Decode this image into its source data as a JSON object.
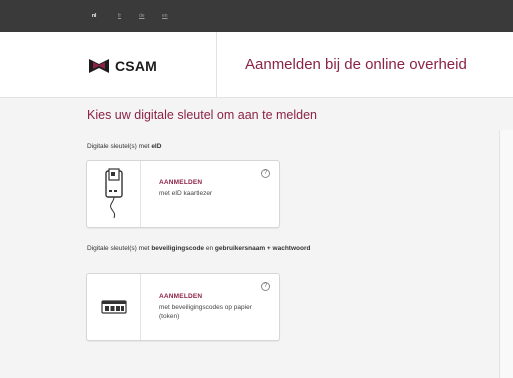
{
  "languages": [
    {
      "label": "nl",
      "active": true
    },
    {
      "label": "fr",
      "active": false
    },
    {
      "label": "de",
      "active": false
    },
    {
      "label": "en",
      "active": false
    }
  ],
  "header": {
    "logo_text": "CSAM",
    "title": "Aanmelden bij de online overheid"
  },
  "main": {
    "title": "Kies uw digitale sleutel om aan te melden",
    "sections": [
      {
        "label_prefix": "Digitale sleutel(s) met ",
        "label_bold": "eID",
        "card": {
          "icon": "eid-card-reader-icon",
          "title": "AANMELDEN",
          "description": "met eID kaartlezer",
          "help": "?"
        }
      },
      {
        "label_prefix": "Digitale sleutel(s) met ",
        "label_bold": "beveiligingscode",
        "label_mid": " en ",
        "label_bold2": "gebruikersnaam + wachtwoord",
        "card": {
          "icon": "security-token-icon",
          "title": "AANMELDEN",
          "description": "met beveiligingscodes op papier (token)",
          "help": "?"
        }
      }
    ]
  },
  "colors": {
    "accent": "#8b2346",
    "top_bar": "#3a3a3a",
    "background": "#f4f4f4"
  }
}
